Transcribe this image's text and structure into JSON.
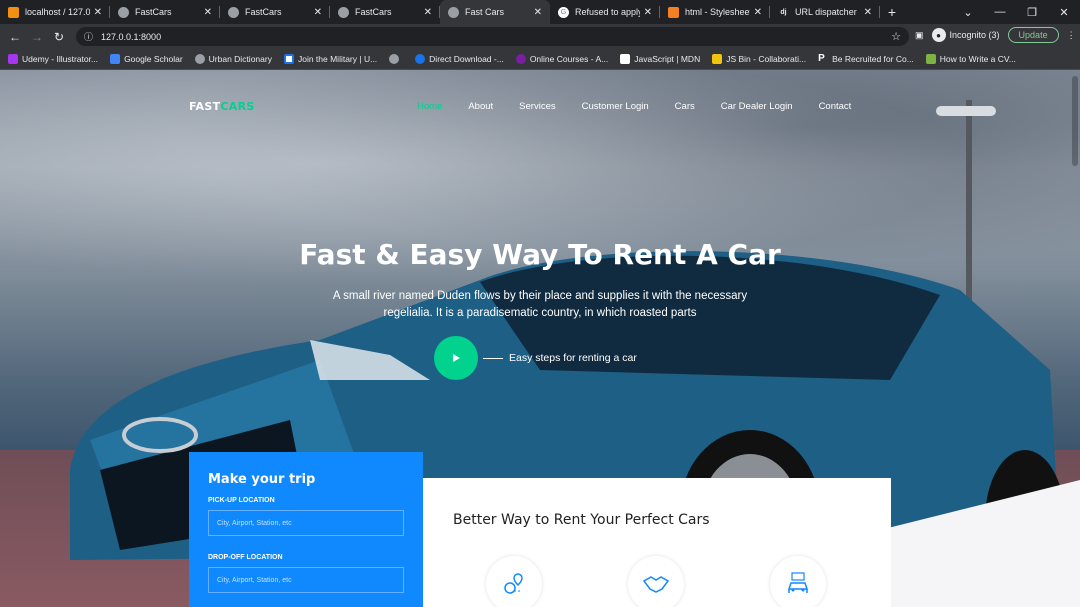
{
  "browser": {
    "tabs": [
      {
        "title": "localhost / 127.0.0",
        "icon": "phpmyadmin-icon",
        "active": false
      },
      {
        "title": "FastCars",
        "icon": "globe-icon",
        "active": false
      },
      {
        "title": "FastCars",
        "icon": "globe-icon",
        "active": false
      },
      {
        "title": "FastCars",
        "icon": "globe-icon",
        "active": false
      },
      {
        "title": "Fast Cars",
        "icon": "globe-icon",
        "active": true
      },
      {
        "title": "Refused to apply",
        "icon": "google-icon",
        "active": false
      },
      {
        "title": "html - Stylesheet",
        "icon": "stackoverflow-icon",
        "active": false
      },
      {
        "title": "URL dispatcher | D",
        "icon": "django-icon",
        "active": false
      }
    ],
    "new_tab": "+",
    "url": "127.0.0.1:8000",
    "profile_label": "Incognito (3)",
    "update_label": "Update",
    "bookmarks": [
      {
        "label": "Udemy - Illustrator...",
        "icon": "udemy-icon"
      },
      {
        "label": "Google Scholar",
        "icon": "scholar-icon"
      },
      {
        "label": "Urban Dictionary",
        "icon": "globe-icon"
      },
      {
        "label": "Join the Military | U...",
        "icon": "military-icon"
      },
      {
        "label": "",
        "icon": "globe-icon"
      },
      {
        "label": "Direct Download -...",
        "icon": "globe-icon"
      },
      {
        "label": "Online Courses - A...",
        "icon": "courses-icon"
      },
      {
        "label": "JavaScript | MDN",
        "icon": "mdn-icon"
      },
      {
        "label": "JS Bin - Collaborati...",
        "icon": "jsbin-icon"
      },
      {
        "label": "Be Recruited for Co...",
        "icon": "p-icon"
      },
      {
        "label": "How to Write a CV...",
        "icon": "cv-icon"
      }
    ]
  },
  "site": {
    "logo_part1": "FAST",
    "logo_part2": "CARS",
    "menu": [
      "Home",
      "About",
      "Services",
      "Customer Login",
      "Cars",
      "Car Dealer Login",
      "Contact"
    ],
    "active_menu": "Home",
    "hero_title": "Fast & Easy Way To Rent A Car",
    "hero_sub_line1": "A small river named Duden flows by their place and supplies it with the necessary",
    "hero_sub_line2": "regelialia. It is a paradisematic country, in which roasted parts",
    "steps_label": "Easy steps for renting a car",
    "trip": {
      "title": "Make your trip",
      "pickup_label": "PICK-UP LOCATION",
      "pickup_placeholder": "City, Airport, Station, etc",
      "dropoff_label": "DROP-OFF LOCATION",
      "dropoff_placeholder": "City, Airport, Station, etc"
    },
    "better_title": "Better Way to Rent Your Perfect Cars",
    "feature_icons": [
      "location-route-icon",
      "handshake-icon",
      "rent-car-icon"
    ],
    "colors": {
      "accent_green": "#01d28e",
      "accent_blue": "#1089ff"
    }
  }
}
